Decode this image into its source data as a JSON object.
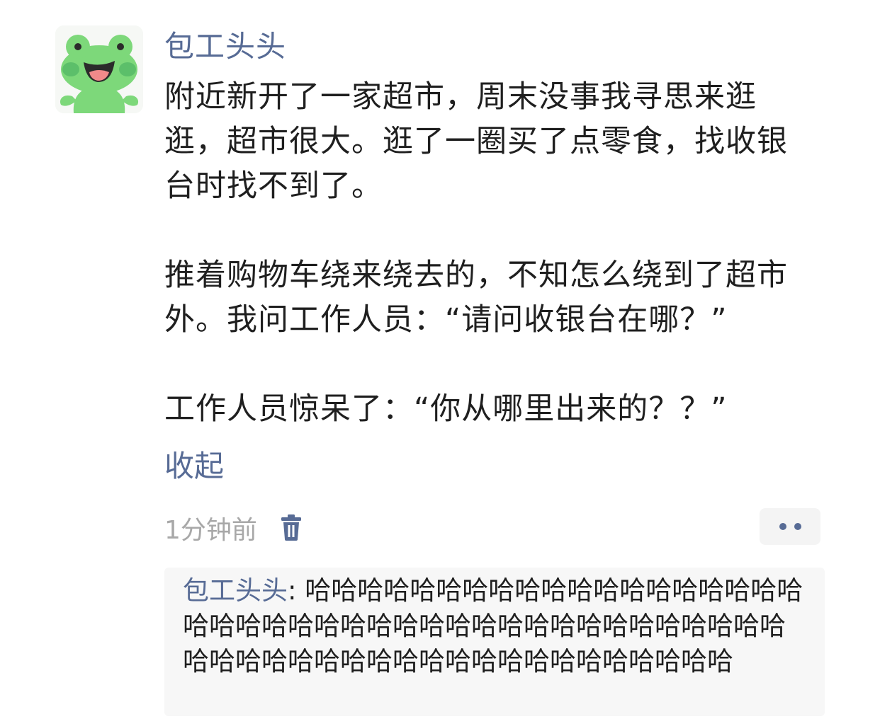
{
  "post": {
    "author": "包工头头",
    "paragraphs": [
      "附近新开了一家超市，周末没事我寻思来逛逛，超市很大。逛了一圈买了点零食，找收银台时找不到了。",
      "推着购物车绕来绕去的，不知怎么绕到了超市外。我问工作人员：“请问收银台在哪？”",
      "工作人员惊呆了：“你从哪里出来的？？”"
    ],
    "collapse_label": "收起",
    "timestamp": "1分钟前"
  },
  "icons": {
    "avatar": "green-frog-avatar",
    "delete": "trash-icon",
    "more": "more-dots-icon"
  },
  "colors": {
    "link_blue": "#576b95",
    "timestamp_gray": "#a8a8a8",
    "comment_bg": "#f7f7f7",
    "frog_green": "#7dd87a"
  },
  "comments": [
    {
      "author": "包工头头",
      "separator": ": ",
      "text": "哈哈哈哈哈哈哈哈哈哈哈哈哈哈哈哈哈哈哈哈哈哈哈哈哈哈哈哈哈哈哈哈哈哈哈哈哈哈哈哈哈哈哈哈哈哈哈哈哈哈哈哈哈哈哈哈哈哈哈哈哈哈哈"
    }
  ]
}
